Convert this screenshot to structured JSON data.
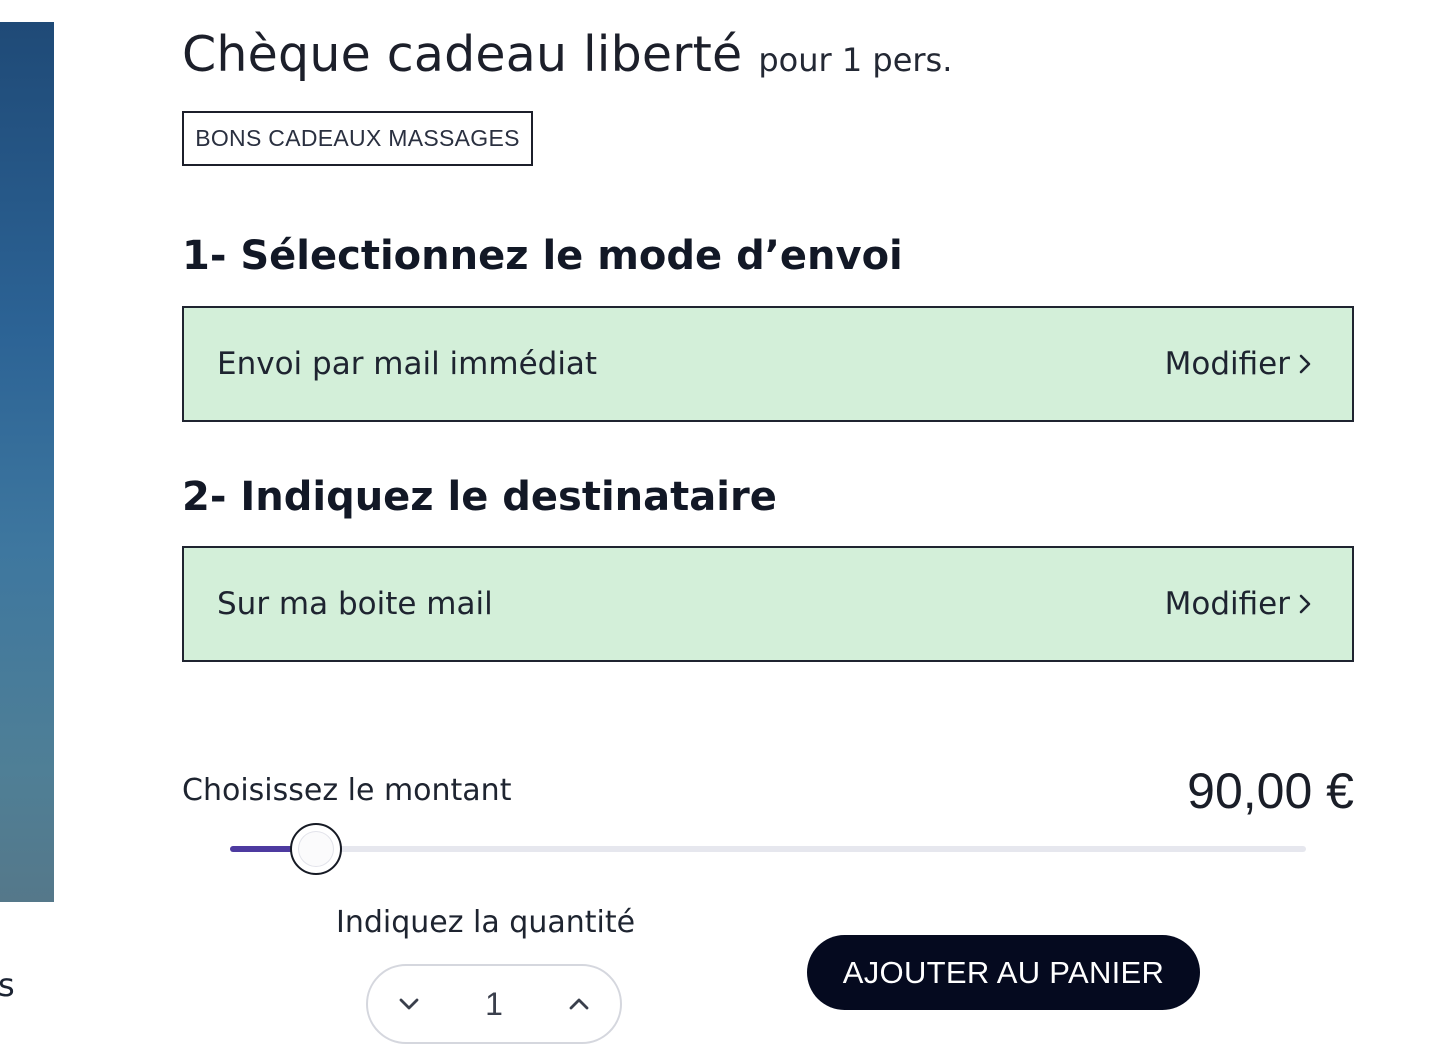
{
  "product": {
    "title": "Chèque cadeau liberté",
    "subtitle": "pour 1 pers.",
    "category_tag": "BONS CADEAUX MASSAGES"
  },
  "edge_text": "s",
  "step1": {
    "title": "1- Sélectionnez le mode d’envoi",
    "selection": "Envoi par mail immédiat",
    "modify_label": "Modifier",
    "modify_icon": "chevron-right-icon"
  },
  "step2": {
    "title": "2- Indiquez le destinataire",
    "selection": "Sur ma boite mail",
    "modify_label": "Modifier",
    "modify_icon": "chevron-right-icon"
  },
  "amount": {
    "label": "Choisissez le montant",
    "value": "90,00 €",
    "slider_level": 0.08
  },
  "quantity": {
    "label": "Indiquez la quantité",
    "value": "1",
    "decrement_icon": "chevron-down-icon",
    "increment_icon": "chevron-up-icon"
  },
  "add_to_cart_label": "AJOUTER AU PANIER",
  "colors": {
    "selected_box_bg": "#d3efd9",
    "slider_fill": "#4d3aa0",
    "button_bg": "#050a1f"
  }
}
